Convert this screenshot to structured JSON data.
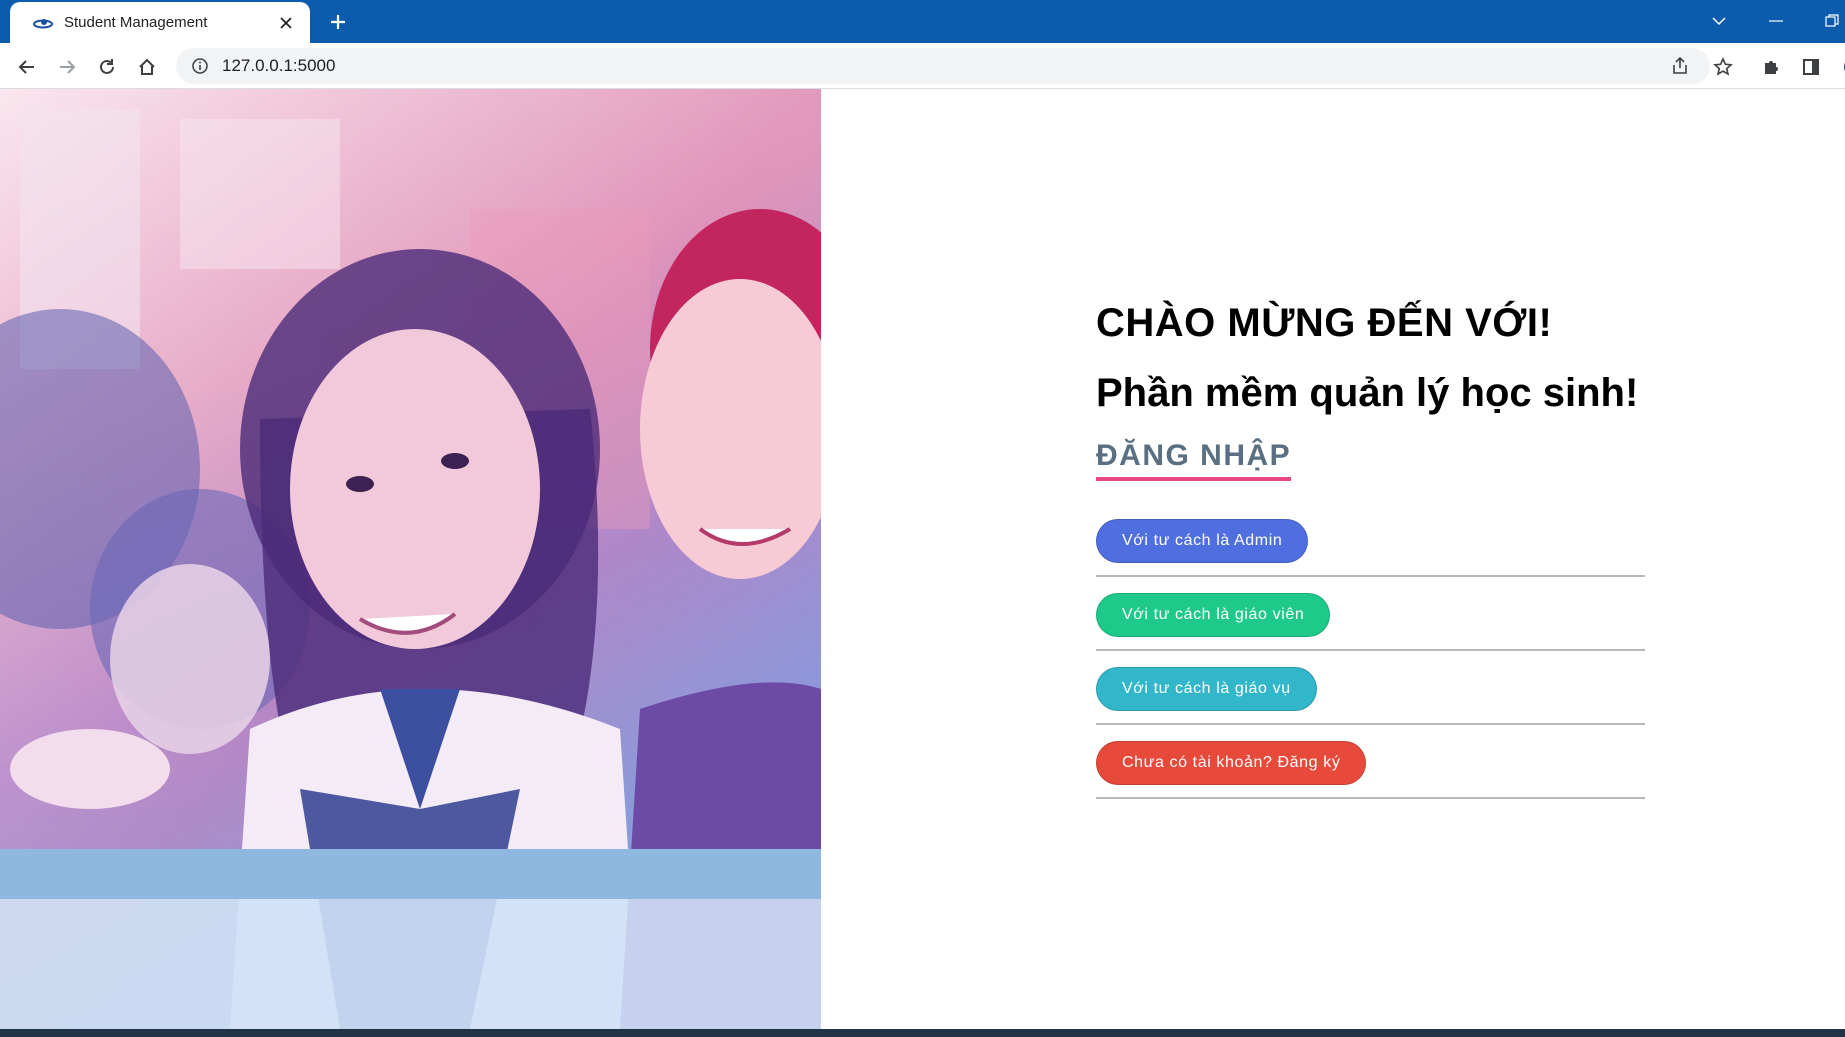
{
  "browser": {
    "tab_title": "Student Management",
    "url": "127.0.0.1:5000"
  },
  "page": {
    "welcome": "CHÀO MỪNG ĐẾN VỚI!",
    "subtitle": "Phần mềm quản lý học sinh!",
    "login_heading": "ĐĂNG NHẬP",
    "buttons": [
      {
        "label": "Với tư cách là Admin",
        "color": "#4f6fe0"
      },
      {
        "label": "Với tư cách là giáo viên",
        "color": "#1ec98a"
      },
      {
        "label": "Với tư cách là giáo vụ",
        "color": "#32b6c9"
      },
      {
        "label": "Chưa có tài khoản? Đăng ký",
        "color": "#e74a3b"
      }
    ]
  }
}
